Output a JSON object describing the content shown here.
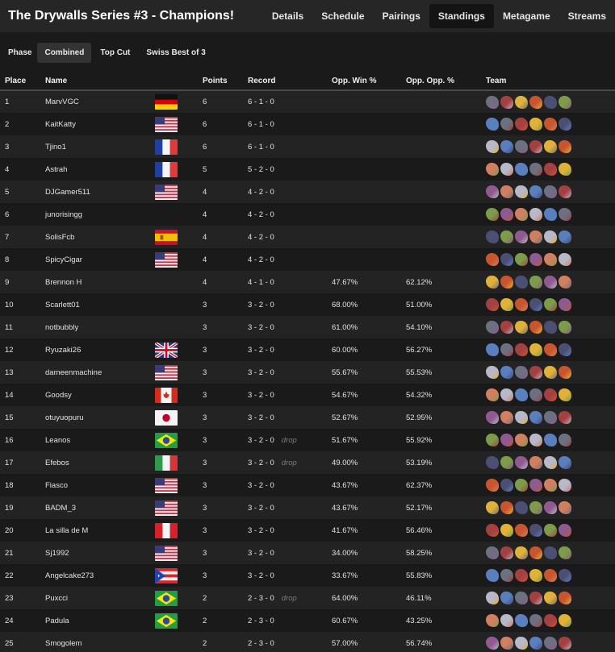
{
  "header": {
    "title": "The Drywalls Series #3 - Champions!",
    "tabs": [
      {
        "label": "Details",
        "active": false
      },
      {
        "label": "Schedule",
        "active": false
      },
      {
        "label": "Pairings",
        "active": false
      },
      {
        "label": "Standings",
        "active": true
      },
      {
        "label": "Metagame",
        "active": false
      },
      {
        "label": "Streams",
        "active": false
      }
    ]
  },
  "phase": {
    "label": "Phase",
    "options": [
      {
        "label": "Combined",
        "active": true
      },
      {
        "label": "Top Cut",
        "active": false
      },
      {
        "label": "Swiss Best of 3",
        "active": false
      }
    ]
  },
  "table": {
    "columns": [
      "Place",
      "Name",
      "",
      "Points",
      "Record",
      "Opp. Win %",
      "Opp. Opp. %",
      "Team"
    ],
    "rows": [
      {
        "place": "1",
        "name": "MarvVGC",
        "flag": "de",
        "points": "6",
        "record": "6 - 1 - 0",
        "drop": "",
        "opp_win": "",
        "opp_opp": ""
      },
      {
        "place": "2",
        "name": "KaitKatty",
        "flag": "us",
        "points": "6",
        "record": "6 - 1 - 0",
        "drop": "",
        "opp_win": "",
        "opp_opp": ""
      },
      {
        "place": "3",
        "name": "Tjino1",
        "flag": "fr",
        "points": "6",
        "record": "6 - 1 - 0",
        "drop": "",
        "opp_win": "",
        "opp_opp": ""
      },
      {
        "place": "4",
        "name": "Astrah",
        "flag": "fr",
        "points": "5",
        "record": "5 - 2 - 0",
        "drop": "",
        "opp_win": "",
        "opp_opp": ""
      },
      {
        "place": "5",
        "name": "DJGamer511",
        "flag": "us",
        "points": "4",
        "record": "4 - 2 - 0",
        "drop": "",
        "opp_win": "",
        "opp_opp": ""
      },
      {
        "place": "6",
        "name": "junorisingg",
        "flag": "",
        "points": "4",
        "record": "4 - 2 - 0",
        "drop": "",
        "opp_win": "",
        "opp_opp": ""
      },
      {
        "place": "7",
        "name": "SolisFcb",
        "flag": "es",
        "points": "4",
        "record": "4 - 2 - 0",
        "drop": "",
        "opp_win": "",
        "opp_opp": ""
      },
      {
        "place": "8",
        "name": "SpicyCigar",
        "flag": "us",
        "points": "4",
        "record": "4 - 2 - 0",
        "drop": "",
        "opp_win": "",
        "opp_opp": ""
      },
      {
        "place": "9",
        "name": "Brennon H",
        "flag": "",
        "points": "4",
        "record": "4 - 1 - 0",
        "drop": "",
        "opp_win": "47.67%",
        "opp_opp": "62.12%"
      },
      {
        "place": "10",
        "name": "Scarlett01",
        "flag": "",
        "points": "3",
        "record": "3 - 2 - 0",
        "drop": "",
        "opp_win": "68.00%",
        "opp_opp": "51.00%"
      },
      {
        "place": "11",
        "name": "notbubbly",
        "flag": "",
        "points": "3",
        "record": "3 - 2 - 0",
        "drop": "",
        "opp_win": "61.00%",
        "opp_opp": "54.10%"
      },
      {
        "place": "12",
        "name": "Ryuzaki26",
        "flag": "gb",
        "points": "3",
        "record": "3 - 2 - 0",
        "drop": "",
        "opp_win": "60.00%",
        "opp_opp": "56.27%"
      },
      {
        "place": "13",
        "name": "dameenmachine",
        "flag": "us",
        "points": "3",
        "record": "3 - 2 - 0",
        "drop": "",
        "opp_win": "55.67%",
        "opp_opp": "55.53%"
      },
      {
        "place": "14",
        "name": "Goodsy",
        "flag": "ca",
        "points": "3",
        "record": "3 - 2 - 0",
        "drop": "",
        "opp_win": "54.67%",
        "opp_opp": "54.32%"
      },
      {
        "place": "15",
        "name": "otuyuopuru",
        "flag": "jp",
        "points": "3",
        "record": "3 - 2 - 0",
        "drop": "",
        "opp_win": "52.67%",
        "opp_opp": "52.95%"
      },
      {
        "place": "16",
        "name": "Leanos",
        "flag": "br",
        "points": "3",
        "record": "3 - 2 - 0",
        "drop": "drop",
        "opp_win": "51.67%",
        "opp_opp": "55.92%"
      },
      {
        "place": "17",
        "name": "Efebos",
        "flag": "it",
        "points": "3",
        "record": "3 - 2 - 0",
        "drop": "drop",
        "opp_win": "49.00%",
        "opp_opp": "53.19%"
      },
      {
        "place": "18",
        "name": "Fiasco",
        "flag": "us",
        "points": "3",
        "record": "3 - 2 - 0",
        "drop": "",
        "opp_win": "43.67%",
        "opp_opp": "62.37%"
      },
      {
        "place": "19",
        "name": "BADM_3",
        "flag": "us",
        "points": "3",
        "record": "3 - 2 - 0",
        "drop": "",
        "opp_win": "43.67%",
        "opp_opp": "52.17%"
      },
      {
        "place": "20",
        "name": "La silla de M",
        "flag": "pe",
        "points": "3",
        "record": "3 - 2 - 0",
        "drop": "",
        "opp_win": "41.67%",
        "opp_opp": "56.46%"
      },
      {
        "place": "21",
        "name": "Sj1992",
        "flag": "us",
        "points": "3",
        "record": "3 - 2 - 0",
        "drop": "",
        "opp_win": "34.00%",
        "opp_opp": "58.25%"
      },
      {
        "place": "22",
        "name": "Angelcake273",
        "flag": "pr",
        "points": "3",
        "record": "3 - 2 - 0",
        "drop": "",
        "opp_win": "33.67%",
        "opp_opp": "55.83%"
      },
      {
        "place": "23",
        "name": "Puxcci",
        "flag": "br",
        "points": "2",
        "record": "2 - 3 - 0",
        "drop": "drop",
        "opp_win": "64.00%",
        "opp_opp": "46.11%"
      },
      {
        "place": "24",
        "name": "Padula",
        "flag": "br",
        "points": "2",
        "record": "2 - 3 - 0",
        "drop": "",
        "opp_win": "60.67%",
        "opp_opp": "43.25%"
      },
      {
        "place": "25",
        "name": "Smogolem",
        "flag": "",
        "points": "2",
        "record": "2 - 3 - 0",
        "drop": "",
        "opp_win": "57.00%",
        "opp_opp": "56.74%"
      }
    ]
  },
  "sprite_colors": [
    "#6d7080",
    "#c8552e",
    "#8f5a8f",
    "#5a7fbf",
    "#e0b23a",
    "#7d9c4a",
    "#b8b8c8",
    "#a34040",
    "#4a4f73",
    "#d08060"
  ]
}
